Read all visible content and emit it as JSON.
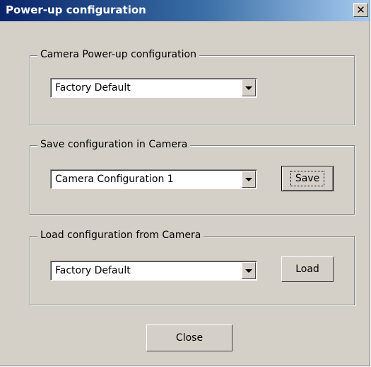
{
  "window": {
    "title": "Power-up configuration",
    "close_glyph": "✕"
  },
  "groups": {
    "powerup": {
      "label": "Camera Power-up configuration",
      "selected": "Factory Default"
    },
    "save": {
      "label": "Save configuration in Camera",
      "selected": "Camera Configuration 1",
      "button_label": "Save"
    },
    "load": {
      "label": "Load configuration from Camera",
      "selected": "Factory Default",
      "button_label": "Load"
    }
  },
  "footer": {
    "close_label": "Close"
  },
  "icons": {
    "close": "close-icon",
    "dropdown": "chevron-down-icon"
  },
  "colors": {
    "title_bar": "#0a246a",
    "dialog_bg": "#d4d0c8"
  }
}
